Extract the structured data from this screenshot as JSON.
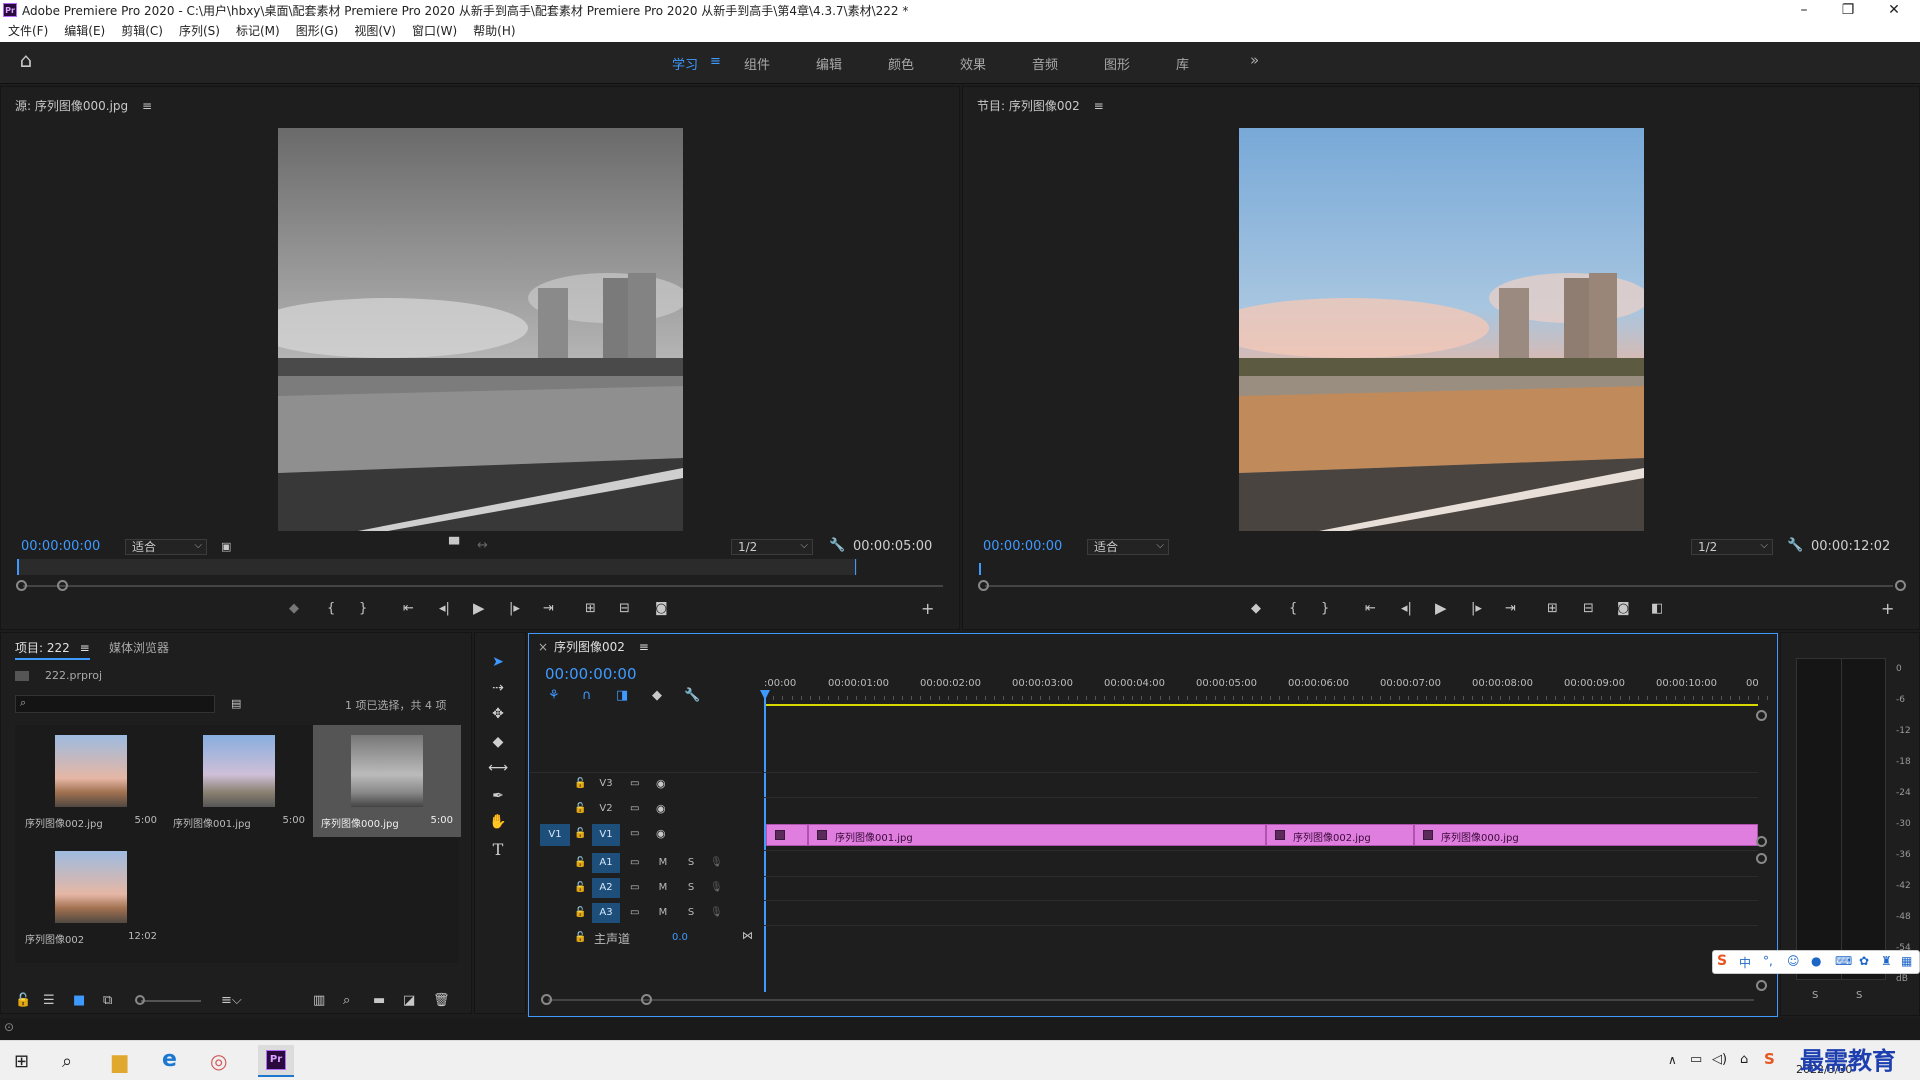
{
  "window": {
    "title": "Adobe Premiere Pro 2020 - C:\\用户\\hbxy\\桌面\\配套素材 Premiere Pro 2020 从新手到高手\\配套素材 Premiere Pro 2020 从新手到高手\\第4章\\4.3.7\\素材\\222 *",
    "logo": "Pr",
    "minimize": "–",
    "restore": "❐",
    "close": "✕"
  },
  "menu": [
    "文件(F)",
    "编辑(E)",
    "剪辑(C)",
    "序列(S)",
    "标记(M)",
    "图形(G)",
    "视图(V)",
    "窗口(W)",
    "帮助(H)"
  ],
  "workspaces": {
    "items": [
      "学习",
      "组件",
      "编辑",
      "颜色",
      "效果",
      "音频",
      "图形",
      "库"
    ],
    "active": "学习",
    "more": "»",
    "menu_icon": "≡",
    "home_icon": "⌂"
  },
  "source": {
    "title": "源: 序列图像000.jpg",
    "timecode": "00:00:00:00",
    "fit": "适合",
    "res": "1/2",
    "duration": "00:00:05:00"
  },
  "program": {
    "title": "节目: 序列图像002",
    "timecode": "00:00:00:00",
    "fit": "适合",
    "res": "1/2",
    "duration": "00:00:12:02"
  },
  "project": {
    "tab": "项目: 222",
    "tab2": "媒体浏览器",
    "file": "222.prproj",
    "selection_info": "1 项已选择，共 4 项",
    "search_placeholder": "",
    "items": [
      {
        "name": "序列图像002.jpg",
        "dur": "5:00"
      },
      {
        "name": "序列图像001.jpg",
        "dur": "5:00"
      },
      {
        "name": "序列图像000.jpg",
        "dur": "5:00"
      },
      {
        "name": "序列图像002",
        "dur": "12:02"
      }
    ]
  },
  "timeline": {
    "tab": "序列图像002",
    "close": "×",
    "timecode": "00:00:00:00",
    "ruler": [
      ":00:00",
      "00:00:01:00",
      "00:00:02:00",
      "00:00:03:00",
      "00:00:04:00",
      "00:00:05:00",
      "00:00:06:00",
      "00:00:07:00",
      "00:00:08:00",
      "00:00:09:00",
      "00:00:10:00",
      "00"
    ],
    "tracks": {
      "v3": "V3",
      "v2": "V2",
      "v1": "V1",
      "v1src": "V1",
      "a1": "A1",
      "a2": "A2",
      "a3": "A3",
      "m": "M",
      "s": "S",
      "master": "主声道",
      "master_val": "0.0"
    },
    "clips": [
      "序列图像001.jpg",
      "序列图像002.jpg",
      "序列图像000.jpg"
    ]
  },
  "meter": {
    "labels": [
      "0",
      "-6",
      "-12",
      "-18",
      "-24",
      "-30",
      "-36",
      "-42",
      "-48",
      "-54",
      "dB"
    ],
    "s1": "S",
    "s2": "S"
  },
  "taskbar": {
    "date": "2022/3/30",
    "ime": "中",
    "watermark": "最需教育"
  },
  "colors": {
    "accent": "#3f9aff",
    "clip": "#e07ee0",
    "playhead": "#3f9aff",
    "work_area": "#d8d800"
  }
}
